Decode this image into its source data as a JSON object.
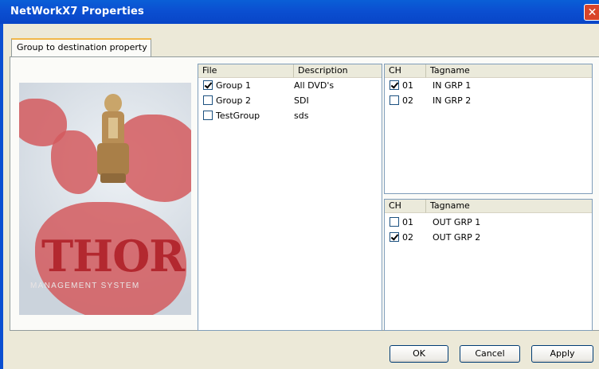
{
  "window": {
    "title": "NetWorkX7 Properties",
    "close_glyph": "✕"
  },
  "tabs": [
    {
      "label": "Group to destination property",
      "active": true
    }
  ],
  "logo": {
    "brand": "THOR",
    "tagline": "MANAGEMENT SYSTEM"
  },
  "file_list": {
    "headers": {
      "file": "File",
      "description": "Description"
    },
    "rows": [
      {
        "name": "Group 1",
        "description": "All DVD's",
        "checked": true
      },
      {
        "name": "Group 2",
        "description": "SDI",
        "checked": false
      },
      {
        "name": "TestGroup",
        "description": "sds",
        "checked": false
      }
    ]
  },
  "in_list": {
    "headers": {
      "ch": "CH",
      "tagname": "Tagname"
    },
    "rows": [
      {
        "ch": "01",
        "tagname": "IN GRP 1",
        "checked": true
      },
      {
        "ch": "02",
        "tagname": "IN GRP 2",
        "checked": false
      }
    ]
  },
  "out_list": {
    "headers": {
      "ch": "CH",
      "tagname": "Tagname"
    },
    "rows": [
      {
        "ch": "01",
        "tagname": "OUT GRP 1",
        "checked": false
      },
      {
        "ch": "02",
        "tagname": "OUT GRP 2",
        "checked": true
      }
    ]
  },
  "buttons": {
    "ok": "OK",
    "cancel": "Cancel",
    "apply": "Apply"
  },
  "colors": {
    "titlebar": "#0b4fd1",
    "dialog_bg": "#ece9d8",
    "close": "#d9452a",
    "logo_red": "#b3282f"
  }
}
